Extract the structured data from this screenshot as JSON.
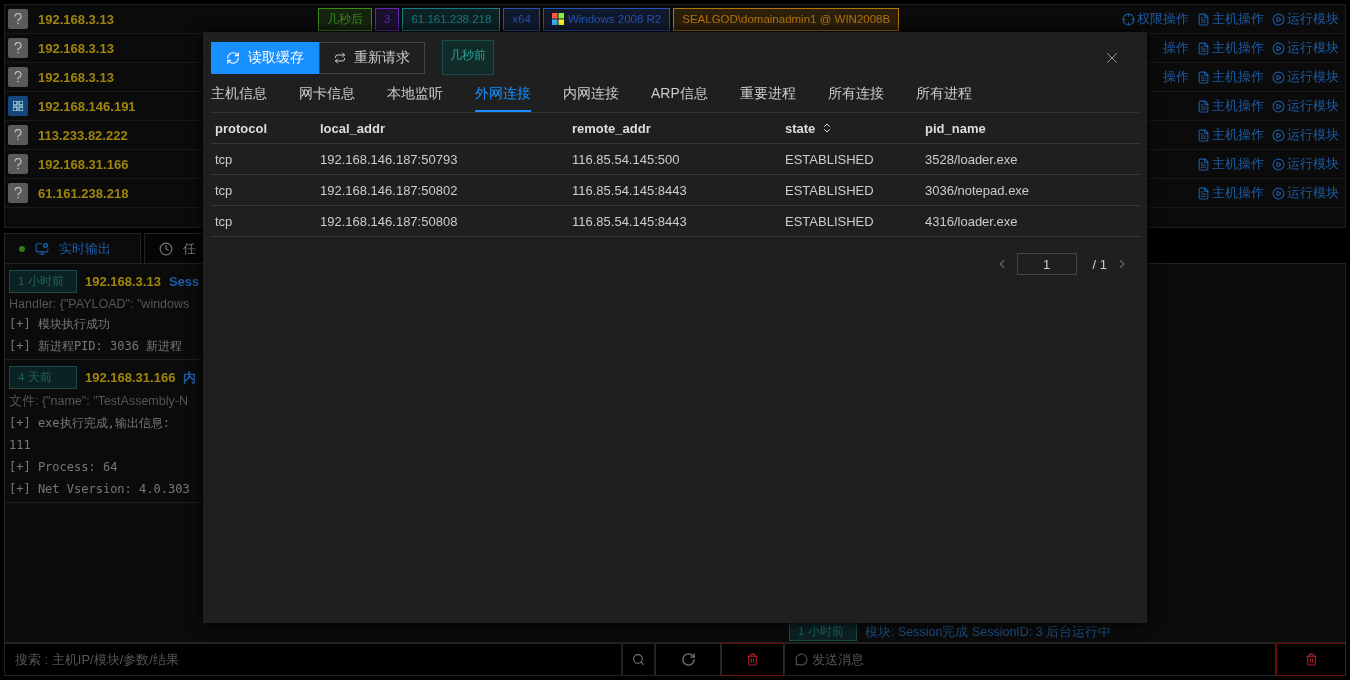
{
  "hosts": [
    {
      "kind": "unknown",
      "ip": "192.168.3.13",
      "tags": [
        {
          "text": "几秒后",
          "color": "#2e6b12"
        },
        {
          "text": "3",
          "color": "#4b1f8a"
        },
        {
          "text": "61.161.238.218",
          "color": "#135f63"
        },
        {
          "text": "x64",
          "color": "#1d3f8a"
        },
        {
          "text": "Windows 2008 R2",
          "color": "#1d3f8a",
          "kind": "os"
        },
        {
          "text": "SEALGOD\\domainadmin1 @ WIN2008B",
          "color": "#8a5a0b"
        }
      ],
      "actions": [
        {
          "kind": "privilege",
          "label": "权限操作"
        },
        {
          "kind": "host",
          "label": "主机操作"
        },
        {
          "kind": "module",
          "label": "运行模块"
        }
      ]
    },
    {
      "kind": "unknown",
      "ip": "192.168.3.13",
      "actions": [
        {
          "kind": "clipped",
          "label": "操作"
        },
        {
          "kind": "host",
          "label": "主机操作"
        },
        {
          "kind": "module",
          "label": "运行模块"
        }
      ]
    },
    {
      "kind": "unknown",
      "ip": "192.168.3.13",
      "actions": [
        {
          "kind": "clipped",
          "label": "操作"
        },
        {
          "kind": "host",
          "label": "主机操作"
        },
        {
          "kind": "module",
          "label": "运行模块"
        }
      ]
    },
    {
      "kind": "windows",
      "ip": "192.168.146.191",
      "actions": [
        {
          "kind": "host",
          "label": "主机操作"
        },
        {
          "kind": "module",
          "label": "运行模块"
        }
      ]
    },
    {
      "kind": "unknown",
      "ip": "113.233.82.222",
      "actions": [
        {
          "kind": "host",
          "label": "主机操作"
        },
        {
          "kind": "module",
          "label": "运行模块"
        }
      ]
    },
    {
      "kind": "unknown",
      "ip": "192.168.31.166",
      "actions": [
        {
          "kind": "host",
          "label": "主机操作"
        },
        {
          "kind": "module",
          "label": "运行模块"
        }
      ]
    },
    {
      "kind": "unknown",
      "ip": "61.161.238.218",
      "actions": [
        {
          "kind": "host",
          "label": "主机操作"
        },
        {
          "kind": "module",
          "label": "运行模块"
        }
      ]
    }
  ],
  "output_tabs": [
    {
      "kind": "live",
      "label": "实时输出",
      "selected": true
    },
    {
      "kind": "tasks",
      "label": "任",
      "selected": false
    }
  ],
  "log_entries": [
    {
      "time": "1 小时前",
      "ip": "192.168.3.13",
      "title": "Sess",
      "detail": "Handler: {\"PAYLOAD\": \"windows",
      "lines": [
        "[+] 模块执行成功",
        "[+] 新进程PID: 3036 新进程"
      ]
    },
    {
      "time": "4 天前",
      "ip": "192.168.31.166",
      "title": "内",
      "detail": "文件: {\"name\": \"TestAssembly-N",
      "lines": [
        "[+] exe执行完成,输出信息:",
        "111",
        "[+] Process: 64",
        "[+] Net Vsersion: 4.0.303"
      ]
    }
  ],
  "side_log": {
    "time": "1 小时前",
    "text": "模块: Session完成 SessionID: 3 后台运行中"
  },
  "search": {
    "placeholder": "搜索 : 主机IP/模块/参数/结果"
  },
  "message": {
    "placeholder": "发送消息"
  },
  "modal": {
    "buttons": [
      {
        "kind": "primary",
        "label": "读取缓存"
      },
      {
        "kind": "default",
        "label": "重新请求"
      }
    ],
    "updated": "几秒前",
    "tabs": [
      {
        "label": "主机信息",
        "selected": false
      },
      {
        "label": "网卡信息",
        "selected": false
      },
      {
        "label": "本地监听",
        "selected": false
      },
      {
        "label": "外网连接",
        "selected": true
      },
      {
        "label": "内网连接",
        "selected": false
      },
      {
        "label": "ARP信息",
        "selected": false
      },
      {
        "label": "重要进程",
        "selected": false
      },
      {
        "label": "所有连接",
        "selected": false
      },
      {
        "label": "所有进程",
        "selected": false
      }
    ],
    "table": {
      "columns": [
        {
          "label": "protocol",
          "sortable": false
        },
        {
          "label": "local_addr",
          "sortable": false
        },
        {
          "label": "remote_addr",
          "sortable": false
        },
        {
          "label": "state",
          "sortable": true
        },
        {
          "label": "pid_name",
          "sortable": false
        }
      ],
      "rows": [
        [
          "tcp",
          "192.168.146.187:50793",
          "116.85.54.145:500",
          "ESTABLISHED",
          "3528/loader.exe"
        ],
        [
          "tcp",
          "192.168.146.187:50802",
          "116.85.54.145:8443",
          "ESTABLISHED",
          "3036/notepad.exe"
        ],
        [
          "tcp",
          "192.168.146.187:50808",
          "116.85.54.145:8443",
          "ESTABLISHED",
          "4316/loader.exe"
        ]
      ]
    },
    "pagination": {
      "page": "1",
      "total": "/ 1"
    }
  }
}
